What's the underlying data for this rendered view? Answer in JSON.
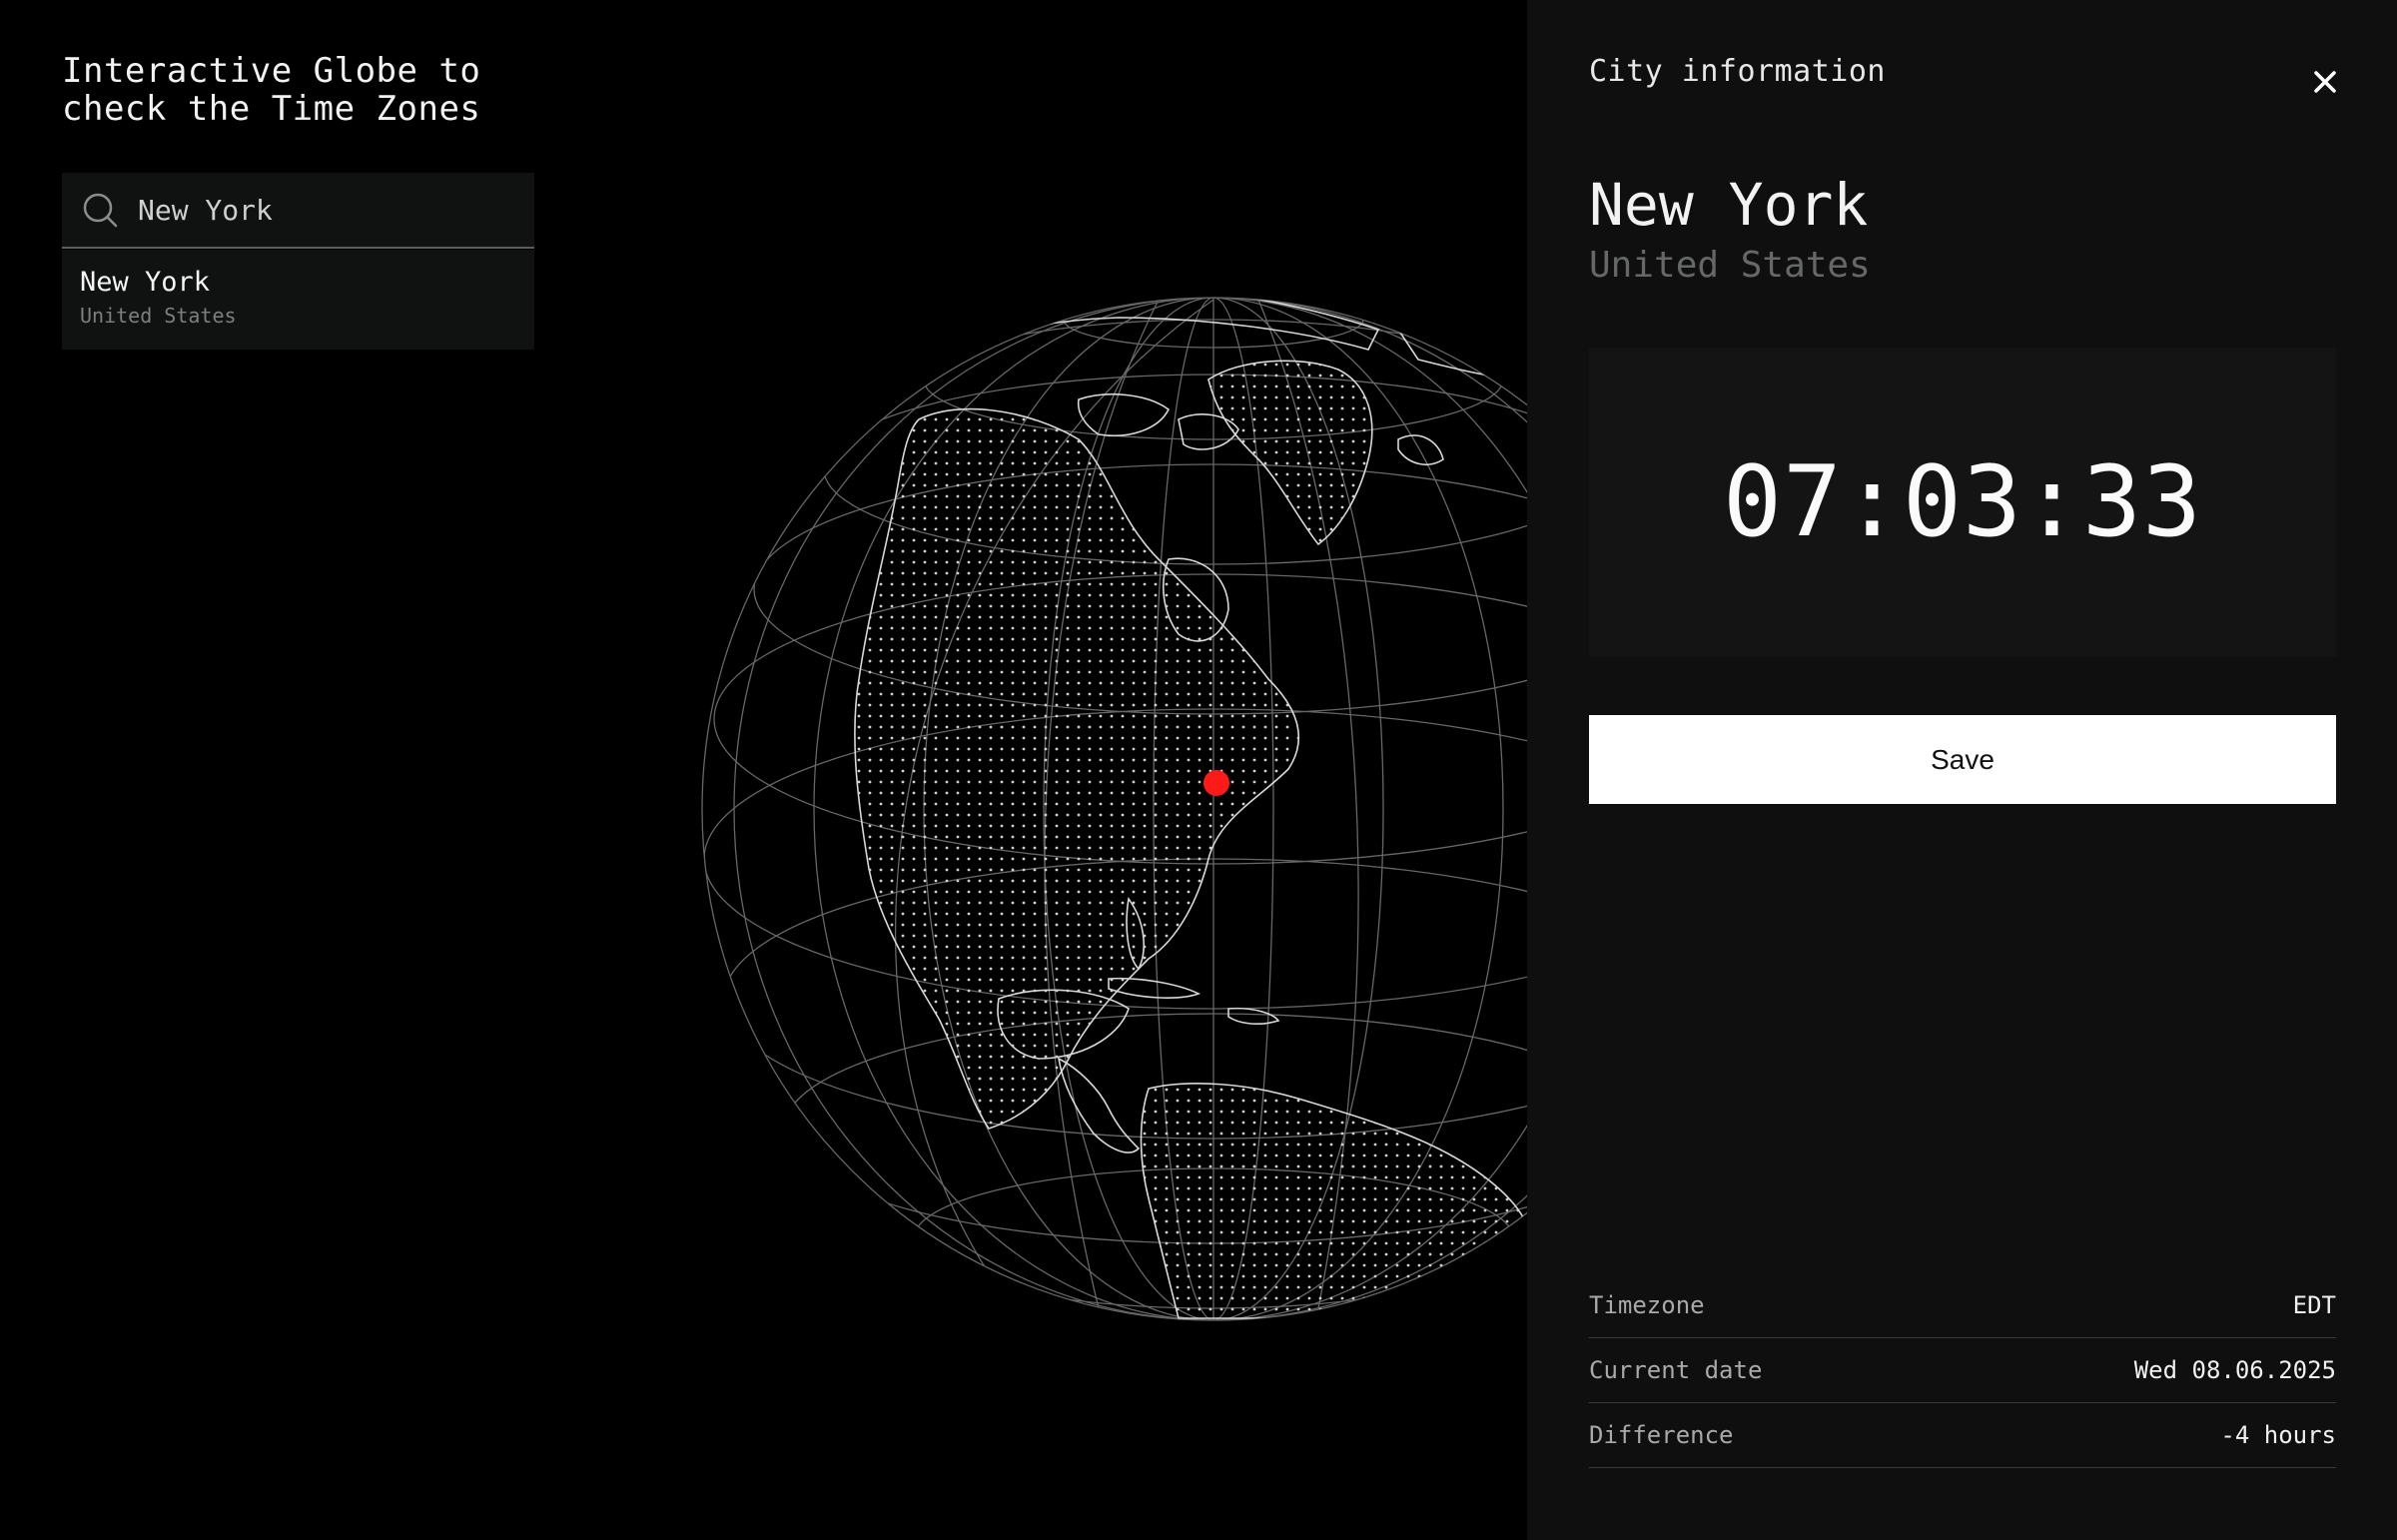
{
  "app": {
    "title": "Interactive Globe to check the Time Zones"
  },
  "search": {
    "value": "New York",
    "placeholder": "New York",
    "results": [
      {
        "name": "New York",
        "country": "United States"
      }
    ]
  },
  "globe": {
    "marker_color": "#ff1a1a",
    "selected_city": "New York"
  },
  "panel": {
    "title": "City information",
    "city": "New York",
    "country": "United States",
    "time": "07:03:33",
    "save_label": "Save",
    "info": [
      {
        "label": "Timezone",
        "value": "EDT"
      },
      {
        "label": "Current date",
        "value": "Wed 08.06.2025"
      },
      {
        "label": "Difference",
        "value": "-4 hours"
      }
    ]
  },
  "icons": {
    "search": "search-icon",
    "close": "close-icon"
  },
  "colors": {
    "background": "#000000",
    "panel": "#0f0f0f",
    "accent": "#ff1a1a",
    "button": "#ffffff"
  }
}
